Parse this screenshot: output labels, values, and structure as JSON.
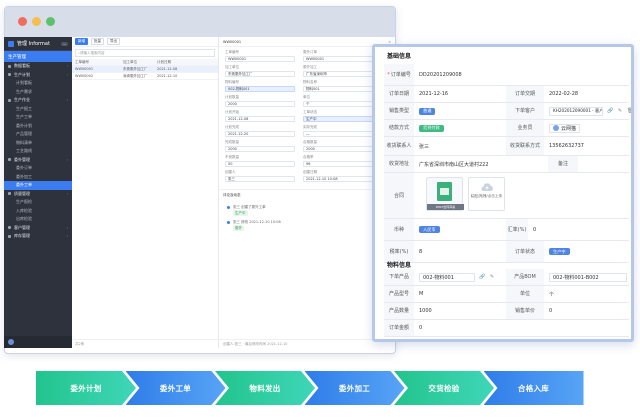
{
  "sidebar": {
    "brand": "管理 Informat",
    "badge": "...",
    "header": "生产管理",
    "groups": [
      {
        "label": "数据看板",
        "subs": []
      },
      {
        "label": "生产计划",
        "subs": [
          "计划看板",
          "生产需求"
        ]
      },
      {
        "label": "生产作业",
        "subs": [
          "生产报工",
          "生产工单",
          "委外计划",
          "产品管理",
          "物料清单",
          "工艺路线"
        ]
      },
      {
        "label": "委外管理",
        "subs": [
          "委外订单",
          "委外加工",
          "委外工单"
        ]
      },
      {
        "label": "质量管理",
        "subs": [
          "生产报检",
          "入库检验",
          "出库检验"
        ]
      },
      {
        "label": "客户管理",
        "subs": []
      },
      {
        "label": "库存管理",
        "subs": []
      }
    ],
    "active_sub": "委外工单"
  },
  "list_panel": {
    "toolbar": [
      "新增",
      "批量",
      "导出"
    ],
    "search_placeholder": "请输入搜索内容",
    "columns": [
      "工单编号",
      "加工单位",
      "计划日期"
    ],
    "rows": [
      {
        "c1": "WW00001",
        "c2": "东莞委外加工厂",
        "c3": "2021-12-08"
      },
      {
        "c1": "WW00002",
        "c2": "深圳委外加工厂",
        "c3": "2021-12-10"
      }
    ],
    "footer": "共2条"
  },
  "detail_panel": {
    "title": "WW00001",
    "fields": [
      {
        "label": "工单编号",
        "value": "WW00001",
        "blue": false
      },
      {
        "label": "委外订单",
        "value": "WW00001",
        "blue": false
      },
      {
        "label": "加工单位",
        "value": "东莞委外加工厂",
        "blue": false
      },
      {
        "label": "委外加工",
        "value": "广东省深圳市",
        "blue": false
      },
      {
        "label": "物料编号",
        "value": "002-物料001",
        "blue": true
      },
      {
        "label": "物料名称",
        "value": "物料001",
        "blue": false
      },
      {
        "label": "计划数量",
        "value": "2000",
        "blue": false
      },
      {
        "label": "单位",
        "value": "个",
        "blue": false
      },
      {
        "label": "计划开始",
        "value": "2021-12-08",
        "blue": false
      },
      {
        "label": "工单状态",
        "value": "生产中",
        "blue": true
      },
      {
        "label": "计划完成",
        "value": "2021-12-20",
        "blue": false
      },
      {
        "label": "实际完成",
        "value": "—",
        "blue": false
      },
      {
        "label": "完成数量",
        "value": "2000",
        "blue": false
      },
      {
        "label": "合格数量",
        "value": "2000",
        "blue": false
      },
      {
        "label": "不良数量",
        "value": "50",
        "blue": false
      },
      {
        "label": "合格率",
        "value": "96",
        "blue": false
      },
      {
        "label": "创建人",
        "value": "张三",
        "blue": false
      },
      {
        "label": "创建日期",
        "value": "2021-12-10 10:08",
        "blue": false
      }
    ],
    "subtitle": "评论及动态",
    "timeline": [
      {
        "title": "张三 创建了委外工单",
        "tag": "生产中"
      },
      {
        "title": "张三 修改 2021-12-10 10:08",
        "tag": "委外"
      }
    ],
    "footer": "创建人:张三 · 最后修改时间 2021-12-10"
  },
  "card": {
    "basic_title": "基础信息",
    "order_no_label": "订单编号",
    "order_no": "DD20201209008",
    "order_date_label": "订单日期",
    "order_date": "2021-12-16",
    "delivery_label": "订单交期",
    "delivery": "2022-02-28",
    "sale_type_label": "销售类型",
    "sale_type": "普通",
    "customer_label": "下单客户",
    "customer": "KH202012090001 - 客户...",
    "settle_label": "结款方式",
    "settle": "货到付款",
    "salesman_label": "业务员",
    "salesman": "云网猫",
    "contact_label": "收货联系人",
    "contact": "张三",
    "phone_label": "收货联系方式",
    "phone": "13562632737",
    "address_label": "收货地址",
    "address": "广东省深圳市南山区大道村222",
    "note_label": "备注",
    "note": "",
    "contract_label": "合同",
    "file_name": "WIST合同草案",
    "upload_text": "粘贴/拖拽/点击上传",
    "currency_label": "币种",
    "currency": "人民币",
    "rate_label": "汇率(%)",
    "rate": "0",
    "tax_label": "税率(%)",
    "tax": "8",
    "status_label": "订单状态",
    "status": "生产中",
    "material_title": "物料信息",
    "product_label": "下单产品",
    "product": "002-物料001",
    "bom_label": "产品BOM",
    "bom": "002-物料001-B002",
    "model_label": "产品型号",
    "model": "M",
    "unit_label": "单位",
    "unit": "个",
    "qty_label": "产品数量",
    "qty": "1000",
    "price_label": "销售单价",
    "price": "0",
    "amount_label": "订单金额",
    "amount": "0"
  },
  "process": {
    "steps": [
      "委外计划",
      "委外工单",
      "物料发出",
      "委外加工",
      "交货检验",
      "合格入库"
    ],
    "colors": [
      "#22c48d",
      "#2e7de9",
      "#22c48d",
      "#2e7de9",
      "#22c48d",
      "#2e7de9"
    ]
  }
}
